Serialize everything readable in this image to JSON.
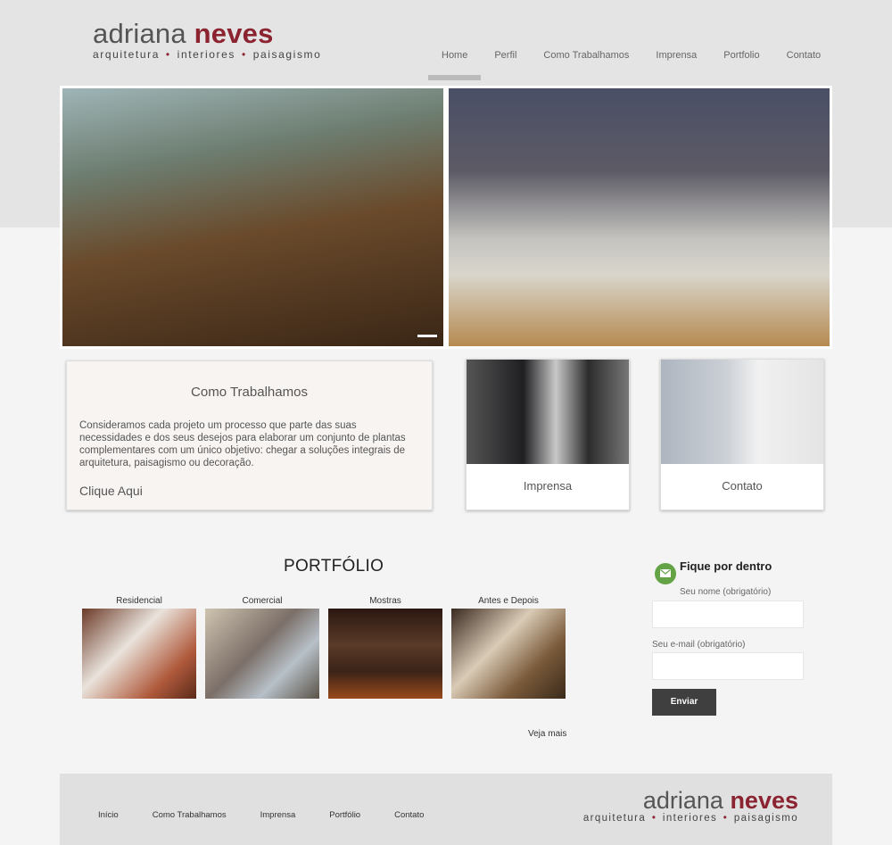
{
  "brand": {
    "first": "adriana",
    "last": "neves",
    "tag_1": "arquitetura",
    "tag_2": "interiores",
    "tag_3": "paisagismo",
    "separator": "•",
    "accent_color": "#8b2330"
  },
  "nav": {
    "items": [
      {
        "label": "Home",
        "active": true
      },
      {
        "label": "Perfil"
      },
      {
        "label": "Como Trabalhamos"
      },
      {
        "label": "Imprensa"
      },
      {
        "label": "Portfolio"
      },
      {
        "label": "Contato"
      }
    ]
  },
  "slider": {
    "slides": [
      {
        "icon": "balcony-photo"
      },
      {
        "icon": "office-photo"
      }
    ]
  },
  "como_trabalhamos": {
    "title": "Como Trabalhamos",
    "text": "Consideramos cada projeto um processo que parte das suas necessidades e dos seus desejos para elaborar um conjunto de plantas complementares com um único objetivo: chegar a soluções integrais de arquitetura, paisagismo ou decoração.",
    "cta": "Clique Aqui"
  },
  "imprensa": {
    "label": "Imprensa"
  },
  "contato_card": {
    "label": "Contato"
  },
  "portfolio": {
    "title": "PORTFÓLIO",
    "items": [
      {
        "label": "Residencial"
      },
      {
        "label": "Comercial"
      },
      {
        "label": "Mostras"
      },
      {
        "label": "Antes e Depois"
      }
    ],
    "more": "Veja mais"
  },
  "newsletter": {
    "title": "Fique por dentro",
    "name_label": "Seu nome (obrigatório)",
    "email_label": "Seu e-mail (obrigatório)",
    "submit": "Enviar",
    "icon_color": "#63a346"
  },
  "footer": {
    "nav": [
      "Início",
      "Como Trabalhamos",
      "Imprensa",
      "Portfólio",
      "Contato"
    ]
  }
}
